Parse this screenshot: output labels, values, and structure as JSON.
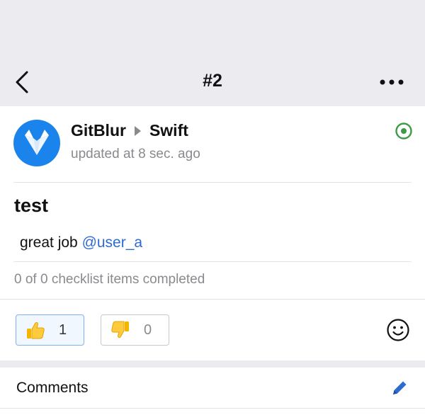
{
  "nav": {
    "title": "#2",
    "back_icon": "chevron-left-icon",
    "more_icon": "ellipsis-icon"
  },
  "header": {
    "repo_owner": "GitBlur",
    "repo_name": "Swift",
    "updated": "updated at 8 sec. ago",
    "avatar_icon": "gitlab-fox-icon",
    "status_icon": "issue-open-icon",
    "status_color": "#3d9a47"
  },
  "issue": {
    "title": "test",
    "body_prefix": "great job ",
    "mention": "@user_a",
    "checklist": "0 of 0 checklist items completed"
  },
  "reactions": [
    {
      "icon": "thumbs-up-icon",
      "count": "1",
      "selected": true
    },
    {
      "icon": "thumbs-down-icon",
      "count": "0",
      "selected": false
    }
  ],
  "comments": {
    "label": "Comments",
    "edit_icon": "pencil-icon"
  },
  "colors": {
    "accent": "#2e6bd1",
    "avatar_bg": "#1b83ec",
    "nav_bg": "#ebebf0"
  }
}
